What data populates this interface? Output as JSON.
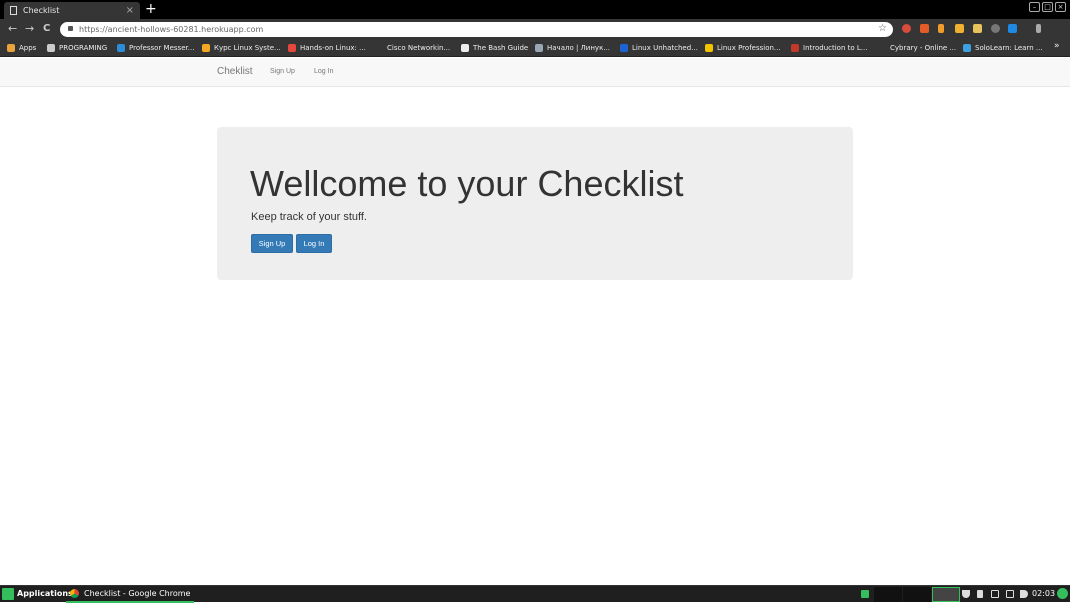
{
  "browser": {
    "tab_title": "Checklist",
    "tab_close": "×",
    "new_tab": "+",
    "url": "https://ancient-hollows-60281.herokuapp.com",
    "back": "←",
    "forward": "→",
    "reload": "C",
    "star": "☆",
    "menu": "⋮",
    "bookmarks": [
      {
        "label": "Apps",
        "icon": "apps-grid-icon",
        "color": "#e8a33c"
      },
      {
        "label": "PROGRAMING",
        "icon": "folder-icon",
        "color": "#cccccc"
      },
      {
        "label": "Professor Messer...",
        "icon": "professor-messer-icon",
        "color": "#2e8bd8"
      },
      {
        "label": "Курс Linux Syste...",
        "icon": "course-icon",
        "color": "#f5a623"
      },
      {
        "label": "Hands-on Linux: ...",
        "icon": "hands-on-icon",
        "color": "#e4473c"
      },
      {
        "label": "Cisco Networkin...",
        "icon": "",
        "color": "#353535"
      },
      {
        "label": "The Bash Guide",
        "icon": "doc-icon",
        "color": "#eeeeee"
      },
      {
        "label": "Начало | Линук...",
        "icon": "globe-icon",
        "color": "#9aa7b5"
      },
      {
        "label": "Linux Unhatched...",
        "icon": "netacad-icon",
        "color": "#1e63d6"
      },
      {
        "label": "Linux Profession...",
        "icon": "lpi-icon",
        "color": "#f2c400"
      },
      {
        "label": "Introduction to L...",
        "icon": "edx-icon",
        "color": "#c0392b"
      },
      {
        "label": "Cybrary - Online ...",
        "icon": "",
        "color": "#353535"
      },
      {
        "label": "SoloLearn: Learn ...",
        "icon": "sololearn-icon",
        "color": "#3aa0e0"
      }
    ],
    "bookmarks_more": "»"
  },
  "site": {
    "brand": "Cheklist",
    "nav": {
      "signup": "Sign Up",
      "login": "Log In"
    },
    "hero": {
      "heading": "Wellcome to your Checklist",
      "subtitle": "Keep track of your stuff.",
      "signup_button": "Sign Up",
      "login_button": "Log In"
    }
  },
  "taskbar": {
    "applications": "Applications",
    "task_title": "Checklist - Google Chrome",
    "clock": "02:03"
  },
  "colors": {
    "primary_button": "#337ab7",
    "jumbotron": "#eeeeee",
    "taskbar_accent": "#35bf5c"
  }
}
